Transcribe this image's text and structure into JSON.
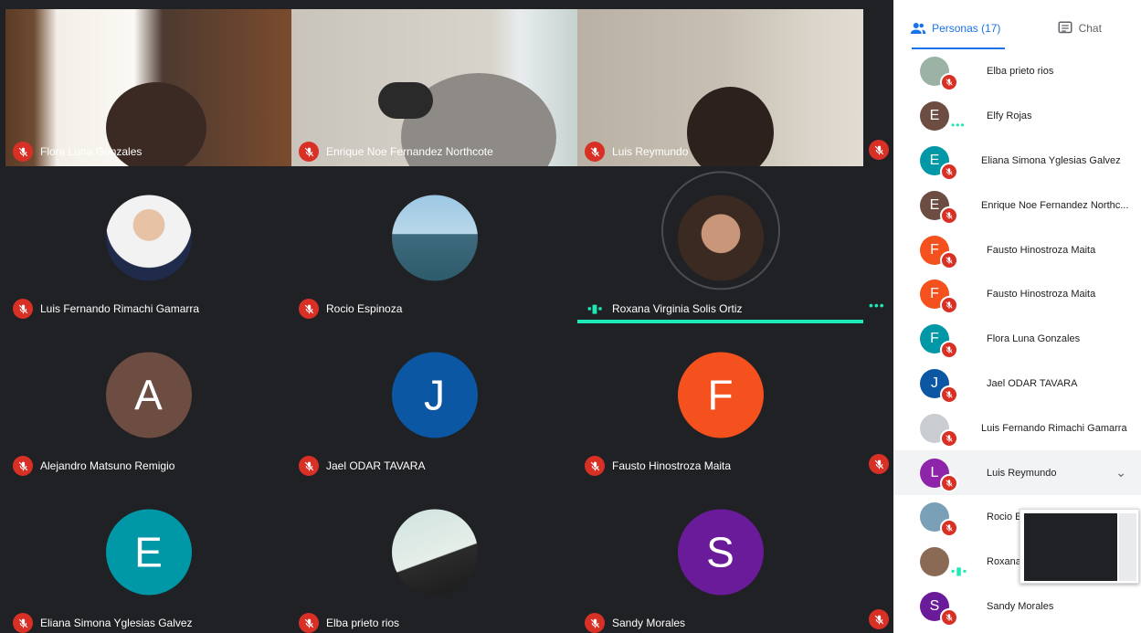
{
  "tiles": [
    {
      "name": "Flora Luna Gonzales",
      "type": "video",
      "bg": "#8a6d52"
    },
    {
      "name": "Enrique Noe Fernandez Northcote",
      "type": "video",
      "bg": "#9ea3a6"
    },
    {
      "name": "Luis Reymundo",
      "type": "video",
      "bg": "#a39a8c"
    },
    {
      "name": "Luis Fernando Rimachi Gamarra",
      "type": "photo"
    },
    {
      "name": "Rocio Espinoza",
      "type": "photo"
    },
    {
      "name": "Roxana Virginia Solis Ortiz",
      "type": "photo",
      "speaking": true
    },
    {
      "name": "Alejandro Matsuno Remigio",
      "type": "initial",
      "initial": "A",
      "color": "#6d4c41"
    },
    {
      "name": "Jael ODAR TAVARA",
      "type": "initial",
      "initial": "J",
      "color": "#0b57a4"
    },
    {
      "name": "Fausto Hinostroza Maita",
      "type": "initial",
      "initial": "F",
      "color": "#f4511e"
    },
    {
      "name": "Eliana Simona Yglesias Galvez",
      "type": "initial",
      "initial": "E",
      "color": "#0097a7"
    },
    {
      "name": "Elba prieto rios",
      "type": "photo"
    },
    {
      "name": "Sandy Morales",
      "type": "initial",
      "initial": "S",
      "color": "#6a1b9a"
    }
  ],
  "panel": {
    "tab_people": "Personas (17)",
    "tab_chat": "Chat",
    "participants": [
      {
        "name": "Elba prieto rios",
        "initial": "",
        "color": "#9bb2a4",
        "photo": true
      },
      {
        "name": "Elfy Rojas",
        "initial": "E",
        "color": "#6d4c41",
        "dots": true
      },
      {
        "name": "Eliana Simona Yglesias Galvez",
        "initial": "E",
        "color": "#0097a7"
      },
      {
        "name": "Enrique Noe Fernandez Northc...",
        "initial": "E",
        "color": "#6d4c41"
      },
      {
        "name": "Fausto Hinostroza Maita",
        "initial": "F",
        "color": "#f4511e"
      },
      {
        "name": "Fausto Hinostroza Maita",
        "initial": "F",
        "color": "#f4511e"
      },
      {
        "name": "Flora Luna Gonzales",
        "initial": "F",
        "color": "#0097a7"
      },
      {
        "name": "Jael ODAR TAVARA",
        "initial": "J",
        "color": "#0b57a4"
      },
      {
        "name": "Luis Fernando Rimachi Gamarra",
        "initial": "",
        "color": "#c9ccd0",
        "photo": true
      },
      {
        "name": "Luis Reymundo",
        "initial": "L",
        "color": "#8e24aa",
        "highlight": true
      },
      {
        "name": "Rocio E",
        "initial": "",
        "color": "#7aa0b8",
        "photo": true
      },
      {
        "name": "Roxana",
        "initial": "",
        "color": "#8b6a55",
        "photo": true,
        "speaking": true
      },
      {
        "name": "Sandy Morales",
        "initial": "S",
        "color": "#6a1b9a"
      }
    ]
  }
}
